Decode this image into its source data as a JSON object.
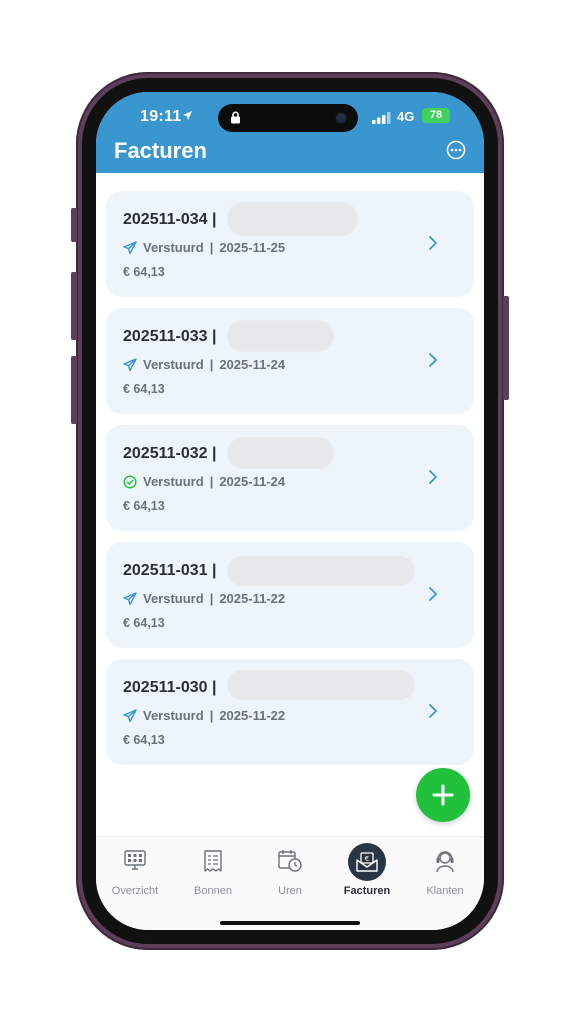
{
  "status_bar": {
    "time": "19:11",
    "network": "4G",
    "battery": "78"
  },
  "header": {
    "title": "Facturen",
    "more_icon": "more-horizontal-circle-icon"
  },
  "invoices": [
    {
      "number": "202511-034 |",
      "status": "Verstuurd",
      "status_icon": "paper-plane-icon",
      "date": "2025-11-25",
      "amount": "€ 64,13"
    },
    {
      "number": "202511-033 |",
      "status": "Verstuurd",
      "status_icon": "paper-plane-icon",
      "date": "2025-11-24",
      "amount": "€ 64,13"
    },
    {
      "number": "202511-032 |",
      "status": "Verstuurd",
      "status_icon": "check-circle-icon",
      "date": "2025-11-24",
      "amount": "€ 64,13"
    },
    {
      "number": "202511-031 |",
      "status": "Verstuurd",
      "status_icon": "paper-plane-icon",
      "date": "2025-11-22",
      "amount": "€ 64,13"
    },
    {
      "number": "202511-030 |",
      "status": "Verstuurd",
      "status_icon": "paper-plane-icon",
      "date": "2025-11-22",
      "amount": "€ 64,13"
    }
  ],
  "separator": "|",
  "fab": {
    "icon": "plus-icon"
  },
  "tabs": [
    {
      "label": "Overzicht",
      "icon": "dashboard-monitor-icon"
    },
    {
      "label": "Bonnen",
      "icon": "receipt-icon"
    },
    {
      "label": "Uren",
      "icon": "calendar-clock-icon"
    },
    {
      "label": "Facturen",
      "icon": "invoice-envelope-icon",
      "active": true
    },
    {
      "label": "Klanten",
      "icon": "customer-support-icon"
    }
  ],
  "colors": {
    "header": "#3a96cf",
    "accent": "#3a96cf",
    "fab": "#22c13d",
    "check": "#22c13d",
    "card": "#eef5fa"
  }
}
